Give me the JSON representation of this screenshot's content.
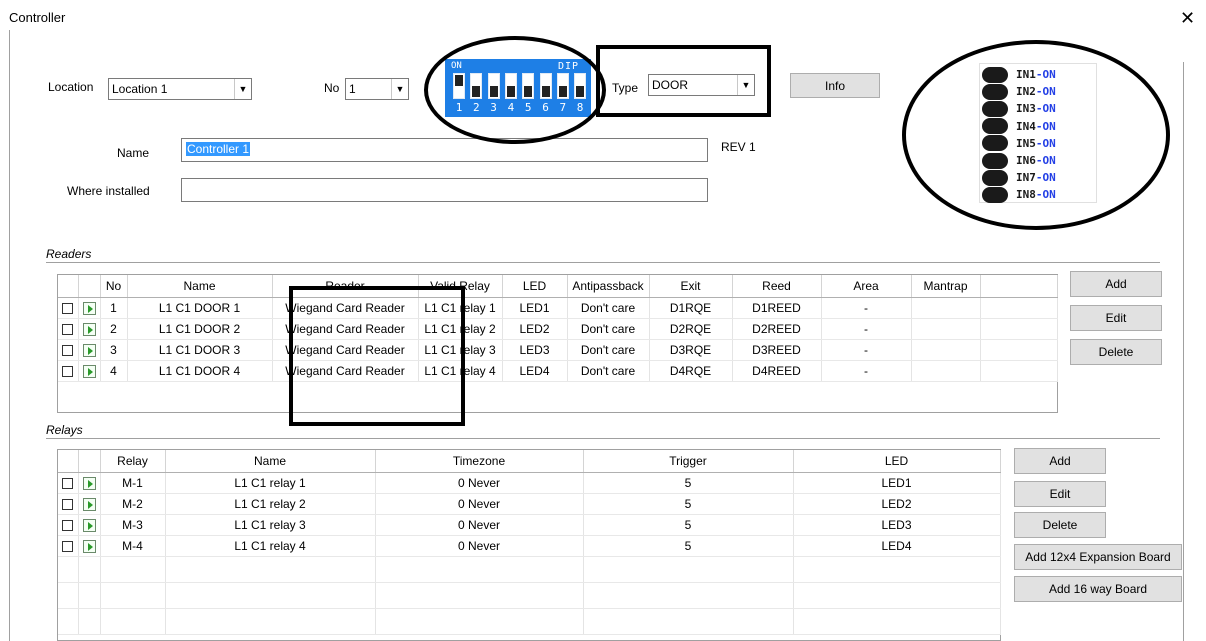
{
  "window": {
    "title": "Controller",
    "close_label": "✕"
  },
  "form": {
    "location_label": "Location",
    "location_value": "Location 1",
    "no_label": "No",
    "no_value": "1",
    "type_label": "Type",
    "type_value": "DOOR",
    "info_label": "Info",
    "name_label": "Name",
    "name_value": "Controller 1",
    "rev_label": "REV 1",
    "where_label": "Where installed",
    "where_value": ""
  },
  "dip": {
    "on_label": "ON",
    "title": "DIP",
    "numbers": [
      "1",
      "2",
      "3",
      "4",
      "5",
      "6",
      "7",
      "8"
    ],
    "switch_states": [
      "on",
      "off",
      "off",
      "off",
      "off",
      "off",
      "off",
      "off"
    ]
  },
  "inputs": [
    {
      "name": "IN1",
      "state": "-ON"
    },
    {
      "name": "IN2",
      "state": "-ON"
    },
    {
      "name": "IN3",
      "state": "-ON"
    },
    {
      "name": "IN4",
      "state": "-ON"
    },
    {
      "name": "IN5",
      "state": "-ON"
    },
    {
      "name": "IN6",
      "state": "-ON"
    },
    {
      "name": "IN7",
      "state": "-ON"
    },
    {
      "name": "IN8",
      "state": "-ON"
    }
  ],
  "readers": {
    "section_title": "Readers",
    "columns": [
      "No",
      "Name",
      "Reader",
      "Valid Relay",
      "LED",
      "Antipassback",
      "Exit",
      "Reed",
      "Area",
      "Mantrap"
    ],
    "rows": [
      {
        "no": "1",
        "name": "L1 C1 DOOR 1",
        "reader": "Wiegand Card Reader",
        "relay": "L1 C1 relay 1",
        "led": "LED1",
        "antipassback": "Don't care",
        "exit": "D1RQE",
        "reed": "D1REED",
        "area": "-",
        "mantrap": ""
      },
      {
        "no": "2",
        "name": "L1 C1 DOOR 2",
        "reader": "Wiegand Card Reader",
        "relay": "L1 C1 relay 2",
        "led": "LED2",
        "antipassback": "Don't care",
        "exit": "D2RQE",
        "reed": "D2REED",
        "area": "-",
        "mantrap": ""
      },
      {
        "no": "3",
        "name": "L1 C1 DOOR 3",
        "reader": "Wiegand Card Reader",
        "relay": "L1 C1 relay 3",
        "led": "LED3",
        "antipassback": "Don't care",
        "exit": "D3RQE",
        "reed": "D3REED",
        "area": "-",
        "mantrap": ""
      },
      {
        "no": "4",
        "name": "L1 C1 DOOR 4",
        "reader": "Wiegand Card Reader",
        "relay": "L1 C1 relay 4",
        "led": "LED4",
        "antipassback": "Don't care",
        "exit": "D4RQE",
        "reed": "D4REED",
        "area": "-",
        "mantrap": ""
      }
    ],
    "buttons": {
      "add": "Add",
      "edit": "Edit",
      "delete": "Delete"
    }
  },
  "relays": {
    "section_title": "Relays",
    "columns": [
      "Relay",
      "Name",
      "Timezone",
      "Trigger",
      "LED"
    ],
    "rows": [
      {
        "relay": "M-1",
        "name": "L1 C1 relay 1",
        "timezone": "0 Never",
        "trigger": "5",
        "led": "LED1"
      },
      {
        "relay": "M-2",
        "name": "L1 C1 relay 2",
        "timezone": "0 Never",
        "trigger": "5",
        "led": "LED2"
      },
      {
        "relay": "M-3",
        "name": "L1 C1 relay 3",
        "timezone": "0 Never",
        "trigger": "5",
        "led": "LED3"
      },
      {
        "relay": "M-4",
        "name": "L1 C1 relay 4",
        "timezone": "0 Never",
        "trigger": "5",
        "led": "LED4"
      }
    ],
    "buttons": {
      "add": "Add",
      "edit": "Edit",
      "delete": "Delete",
      "add_expansion": "Add 12x4 Expansion Board",
      "add_16way": "Add 16 way Board"
    }
  }
}
